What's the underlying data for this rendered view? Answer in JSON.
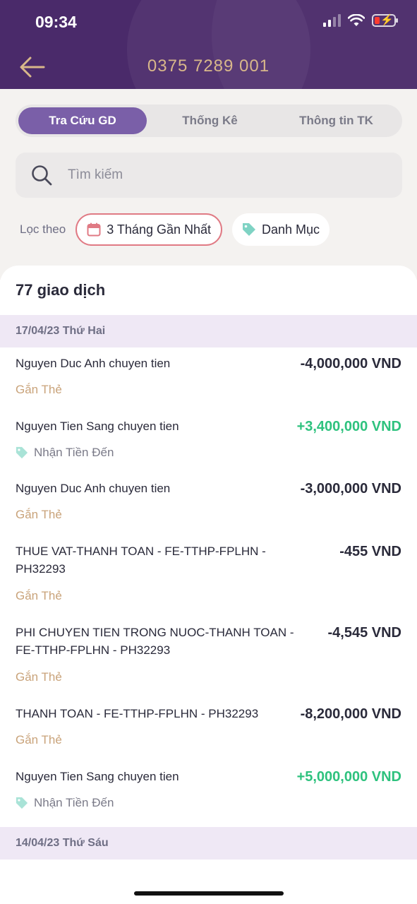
{
  "status": {
    "time": "09:34"
  },
  "header": {
    "account": "0375 7289 001"
  },
  "tabs": [
    {
      "label": "Tra Cứu GD",
      "active": true
    },
    {
      "label": "Thống Kê",
      "active": false
    },
    {
      "label": "Thông tin TK",
      "active": false
    }
  ],
  "search": {
    "placeholder": "Tìm kiếm"
  },
  "filters": {
    "label": "Lọc theo",
    "period": "3 Tháng Gần Nhất",
    "category": "Danh Mục"
  },
  "list": {
    "count": "77 giao dịch",
    "groups": [
      {
        "date": "17/04/23 Thứ Hai"
      },
      {
        "date": "14/04/23 Thứ Sáu"
      }
    ],
    "transactions": [
      {
        "desc": "Nguyen Duc Anh chuyen tien",
        "amount": "-4,000,000 VND",
        "tag": "Gắn Thẻ",
        "kind": "debit"
      },
      {
        "desc": "Nguyen Tien Sang chuyen tien",
        "amount": "+3,400,000 VND",
        "tag": "Nhận Tiền Đến",
        "kind": "credit"
      },
      {
        "desc": "Nguyen Duc Anh chuyen tien",
        "amount": "-3,000,000 VND",
        "tag": "Gắn Thẻ",
        "kind": "debit"
      },
      {
        "desc": "THUE VAT-THANH TOAN - FE-TTHP-FPLHN - PH32293",
        "amount": "-455 VND",
        "tag": "Gắn Thẻ",
        "kind": "debit"
      },
      {
        "desc": "PHI CHUYEN TIEN TRONG NUOC-THANH TOAN - FE-TTHP-FPLHN - PH32293",
        "amount": "-4,545 VND",
        "tag": "Gắn Thẻ",
        "kind": "debit"
      },
      {
        "desc": "THANH TOAN - FE-TTHP-FPLHN - PH32293",
        "amount": "-8,200,000 VND",
        "tag": "Gắn Thẻ",
        "kind": "debit"
      },
      {
        "desc": "Nguyen Tien Sang chuyen tien",
        "amount": "+5,000,000 VND",
        "tag": "Nhận Tiền Đến",
        "kind": "credit"
      }
    ]
  },
  "colors": {
    "header_bg": "#4a2a6a",
    "accent": "#7a5fa8",
    "gold": "#d8b78a",
    "credit": "#2ec27e",
    "period_chip_border": "#e07a84",
    "tag_icon": "#7fd3c4"
  },
  "icons": [
    "back-arrow-icon",
    "signal-icon",
    "wifi-icon",
    "battery-icon",
    "search-icon",
    "calendar-icon",
    "tag-icon"
  ]
}
